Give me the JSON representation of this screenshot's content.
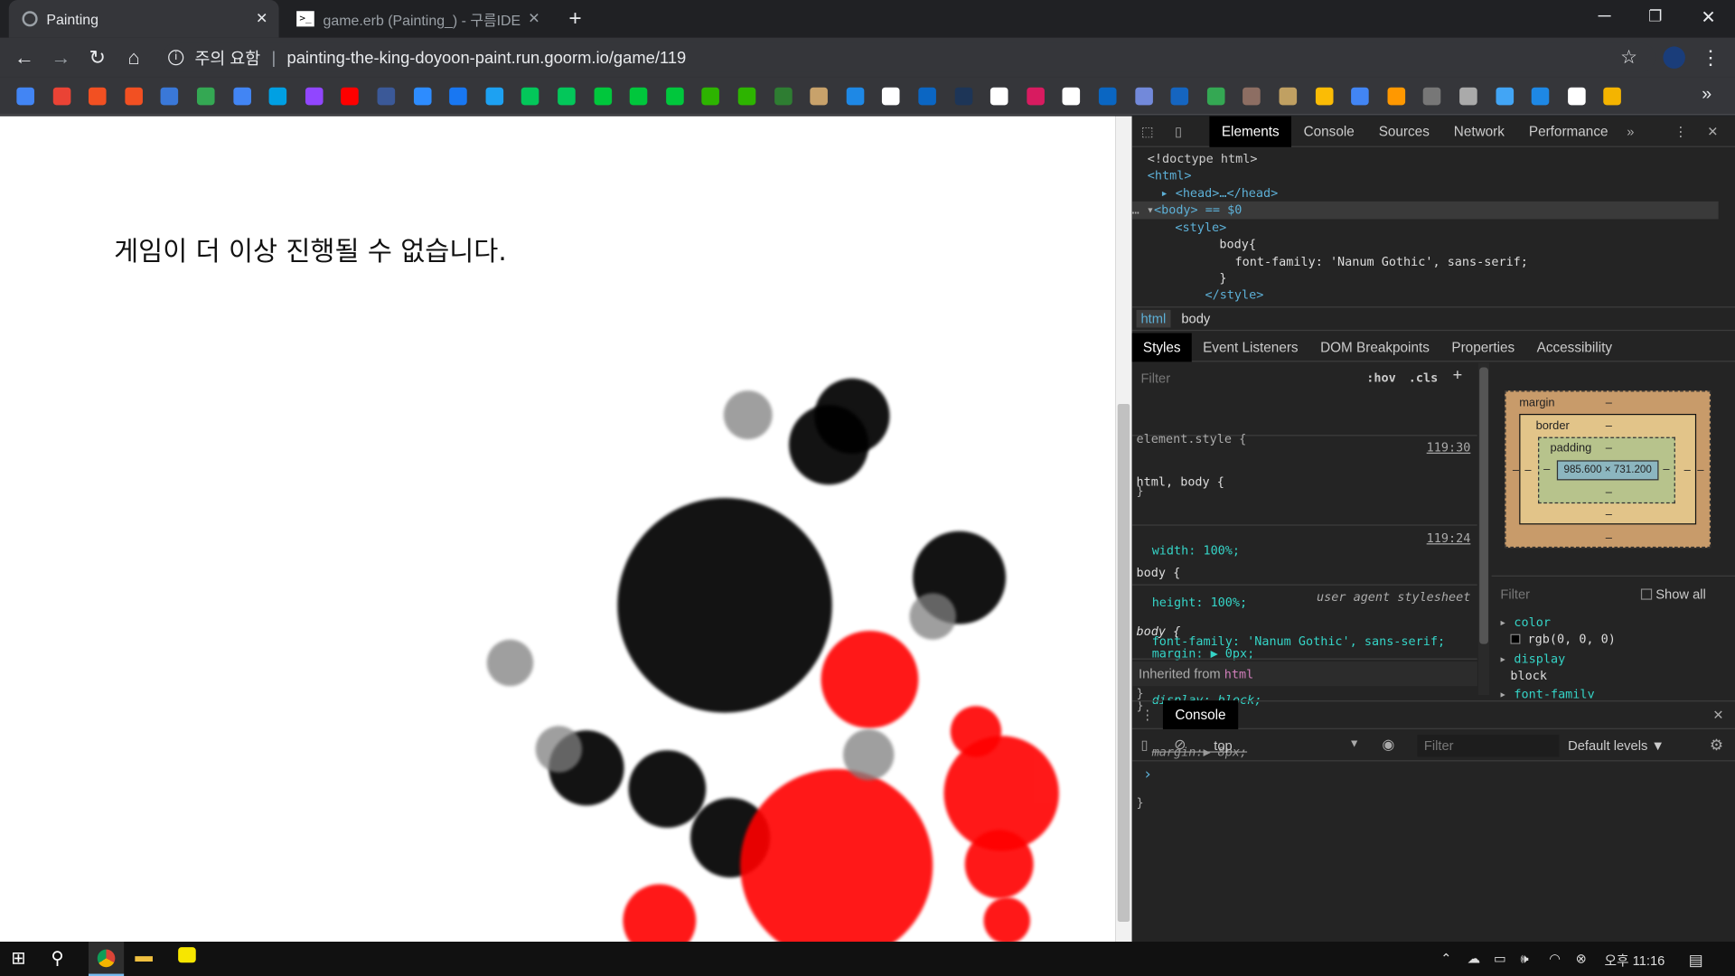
{
  "browser": {
    "tabs": [
      {
        "title": "Painting"
      },
      {
        "title": "game.erb (Painting_) - 구름IDE"
      }
    ],
    "new_tab_symbol": "+",
    "address": {
      "security_label": "주의 요함",
      "url": "painting-the-king-doyoon-paint.run.goorm.io/game/119"
    }
  },
  "page": {
    "message": "게임이 더 이상 진행될 수 없습니다."
  },
  "devtools": {
    "tabs": [
      "Elements",
      "Console",
      "Sources",
      "Network",
      "Performance"
    ],
    "dom": {
      "doctype": "<!doctype html>",
      "html_open": "<html>",
      "head": "<head>…</head>",
      "body": "<body> == $0",
      "style_open": "<style>",
      "css_selector": "body{",
      "css_decl": "font-family: 'Nanum Gothic', sans-serif;",
      "css_close": "}",
      "style_close": "</style>"
    },
    "breadcrumbs": [
      "html",
      "body"
    ],
    "subtabs": [
      "Styles",
      "Event Listeners",
      "DOM Breakpoints",
      "Properties",
      "Accessibility"
    ],
    "styles_filter_placeholder": "Filter",
    "hov": ":hov",
    "cls": ".cls",
    "rules": {
      "element_style": "element.style {",
      "close": "}",
      "r1_selector": "html, body {",
      "r1_source": "119:30",
      "r1_width": "width: 100%;",
      "r1_height": "height: 100%;",
      "r1_margin": "margin: ▶ 0px;",
      "r2_selector": "body {",
      "r2_source": "119:24",
      "r2_font": "font-family: 'Nanum Gothic', sans-serif;",
      "r3_selector": "body {",
      "r3_source": "user agent stylesheet",
      "r3_display": "display: block;",
      "r3_margin": "margin:▶ 8px;",
      "inherited_label": "Inherited from",
      "inherited_tag": "html"
    },
    "boxmodel": {
      "margin_label": "margin",
      "border_label": "border",
      "padding_label": "padding",
      "dash": "–",
      "content_size": "985.600 × 731.200"
    },
    "computed": {
      "filter_placeholder": "Filter",
      "show_all": "Show all",
      "color_prop": "color",
      "color_value": "rgb(0, 0, 0)",
      "display_prop": "display",
      "display_value": "block",
      "font_family_prop": "font-family"
    },
    "console": {
      "tab": "Console",
      "context": "top",
      "filter_placeholder": "Filter",
      "levels": "Default levels ▼",
      "prompt": "›"
    }
  },
  "taskbar": {
    "time": "오후 11:16"
  },
  "chart_data": {
    "type": "scatter",
    "title": "",
    "xlabel": "",
    "ylabel": "",
    "series": [
      {
        "color": "#000000",
        "values": [
          {
            "x": 655,
            "y": 547,
            "r": 97
          },
          {
            "x": 867,
            "y": 522,
            "r": 42
          },
          {
            "x": 770,
            "y": 376,
            "r": 34
          },
          {
            "x": 749,
            "y": 402,
            "r": 36
          },
          {
            "x": 530,
            "y": 694,
            "r": 34
          },
          {
            "x": 603,
            "y": 713,
            "r": 35
          },
          {
            "x": 660,
            "y": 757,
            "r": 36
          }
        ]
      },
      {
        "color": "#ff0000",
        "values": [
          {
            "x": 756,
            "y": 782,
            "r": 87
          },
          {
            "x": 786,
            "y": 614,
            "r": 44
          },
          {
            "x": 905,
            "y": 717,
            "r": 52
          },
          {
            "x": 903,
            "y": 781,
            "r": 31
          },
          {
            "x": 882,
            "y": 661,
            "r": 23
          },
          {
            "x": 596,
            "y": 832,
            "r": 33
          },
          {
            "x": 910,
            "y": 832,
            "r": 21
          }
        ]
      },
      {
        "color": "#808080",
        "values": [
          {
            "x": 676,
            "y": 375,
            "r": 22
          },
          {
            "x": 461,
            "y": 599,
            "r": 21
          },
          {
            "x": 843,
            "y": 557,
            "r": 21
          },
          {
            "x": 785,
            "y": 682,
            "r": 23
          },
          {
            "x": 505,
            "y": 677,
            "r": 21
          }
        ]
      }
    ]
  }
}
